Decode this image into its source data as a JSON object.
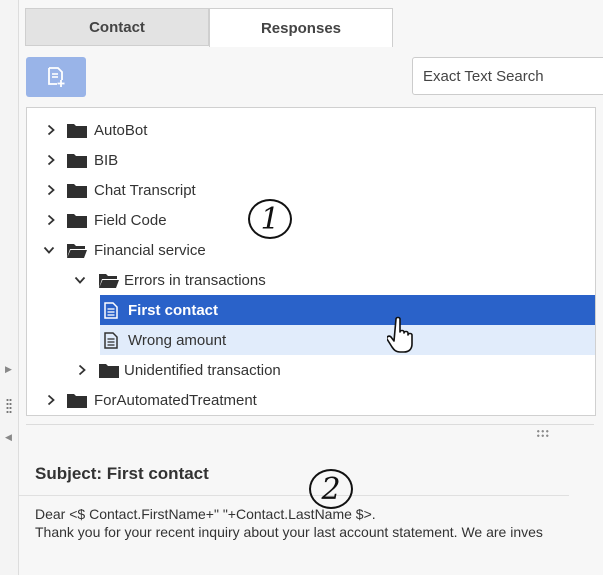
{
  "tabs": {
    "contact": "Contact",
    "responses": "Responses"
  },
  "search": {
    "placeholder": "Exact Text Search"
  },
  "tree": {
    "items": [
      {
        "label": "AutoBot"
      },
      {
        "label": "BIB"
      },
      {
        "label": "Chat Transcript"
      },
      {
        "label": "Field Code"
      },
      {
        "label": "Financial service"
      },
      {
        "label": "Errors in transactions"
      },
      {
        "label": "First contact"
      },
      {
        "label": "Wrong amount"
      },
      {
        "label": "Unidentified transaction"
      },
      {
        "label": "ForAutomatedTreatment"
      }
    ]
  },
  "preview": {
    "subject": "Subject: First contact",
    "line1": "Dear <$ Contact.FirstName+\" \"+Contact.LastName $>.",
    "line2": "Thank you for your recent inquiry about your last account statement. We are inves"
  },
  "callouts": {
    "one": "1",
    "two": "2"
  },
  "colors": {
    "selected": "#2a62c9",
    "hover": "#e1ecfb",
    "add_button": "#99b4e8"
  },
  "icons": [
    "add-response-icon",
    "folder-icon",
    "folder-open-icon",
    "document-icon",
    "chevron-right-icon",
    "chevron-down-icon",
    "hand-cursor-icon"
  ]
}
